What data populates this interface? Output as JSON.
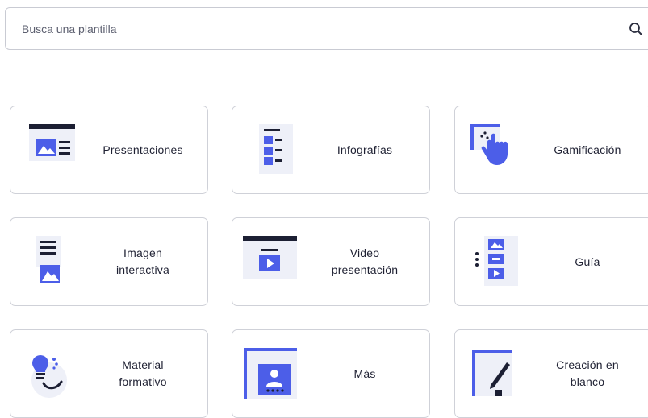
{
  "search": {
    "placeholder": "Busca una plantilla",
    "value": "",
    "icon": "search-icon"
  },
  "categories": [
    {
      "label": "Presentaciones",
      "icon": "presentation-icon"
    },
    {
      "label": "Infografías",
      "icon": "infographic-icon"
    },
    {
      "label": "Gamificación",
      "icon": "gamification-icon"
    },
    {
      "label": "Imagen\ninteractiva",
      "icon": "interactive-image-icon"
    },
    {
      "label": "Video\npresentación",
      "icon": "video-presentation-icon"
    },
    {
      "label": "Guía",
      "icon": "guide-icon"
    },
    {
      "label": "Material\nformativo",
      "icon": "training-material-icon"
    },
    {
      "label": "Más",
      "icon": "more-icon"
    },
    {
      "label": "Creación en\nblanco",
      "icon": "blank-creation-icon"
    }
  ],
  "colors": {
    "accent": "#4c5ee8",
    "dark": "#1c1f33",
    "light_accent": "#c2c9f6",
    "border": "#cfd1d8"
  }
}
